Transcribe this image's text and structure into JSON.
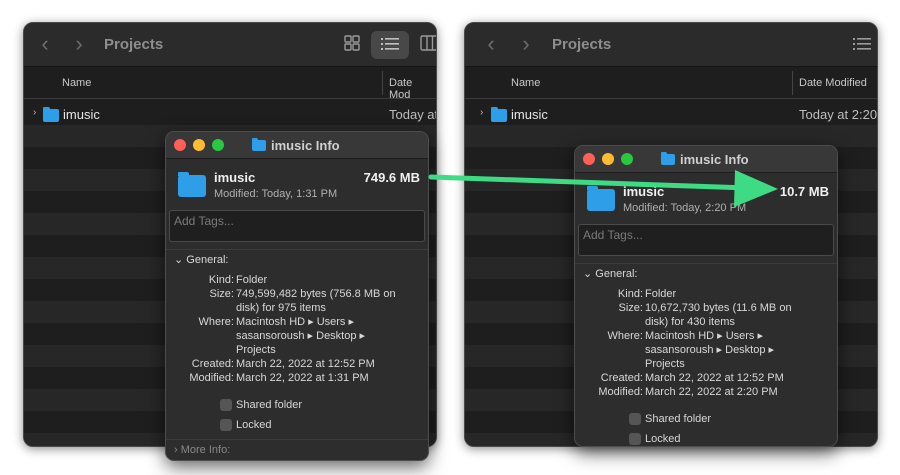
{
  "left_finder": {
    "title": "Projects",
    "col_name": "Name",
    "col_date": "Date Mod",
    "folder_name": "imusic",
    "folder_date": "Today at"
  },
  "right_finder": {
    "title": "Projects",
    "col_name": "Name",
    "col_date": "Date Modified",
    "folder_name": "imusic",
    "folder_date": "Today at 2:20"
  },
  "left_info": {
    "title": "imusic Info",
    "name": "imusic",
    "size": "749.6 MB",
    "modified": "Modified: Today, 1:31 PM",
    "tags_placeholder": "Add Tags...",
    "general_label": "General:",
    "kind_label": "Kind:",
    "kind": "Folder",
    "size_label": "Size:",
    "size_line1": "749,599,482 bytes (756.8 MB on",
    "size_line2": "disk) for 975 items",
    "where_label": "Where:",
    "where_line1": "Macintosh HD ▸ Users ▸",
    "where_line2": "sasansoroush ▸ Desktop ▸",
    "where_line3": "Projects",
    "created_label": "Created:",
    "created": "March 22, 2022 at 12:52 PM",
    "modified_label": "Modified:",
    "modified_full": "March 22, 2022 at 1:31 PM",
    "shared_folder": "Shared folder",
    "locked": "Locked",
    "more_info": "More Info:"
  },
  "right_info": {
    "title": "imusic Info",
    "name": "imusic",
    "size": "10.7 MB",
    "modified": "Modified: Today, 2:20 PM",
    "tags_placeholder": "Add Tags...",
    "general_label": "General:",
    "kind_label": "Kind:",
    "kind": "Folder",
    "size_label": "Size:",
    "size_line1": "10,672,730 bytes (11.6 MB on",
    "size_line2": "disk) for 430 items",
    "where_label": "Where:",
    "where_line1": "Macintosh HD ▸ Users ▸",
    "where_line2": "sasansoroush ▸ Desktop ▸",
    "where_line3": "Projects",
    "created_label": "Created:",
    "created": "March 22, 2022 at 12:52 PM",
    "modified_label": "Modified:",
    "modified_full": "March 22, 2022 at 2:20 PM",
    "shared_folder": "Shared folder",
    "locked": "Locked"
  },
  "colors": {
    "arrow": "#3ddc84",
    "folder": "#2e9ee8"
  }
}
